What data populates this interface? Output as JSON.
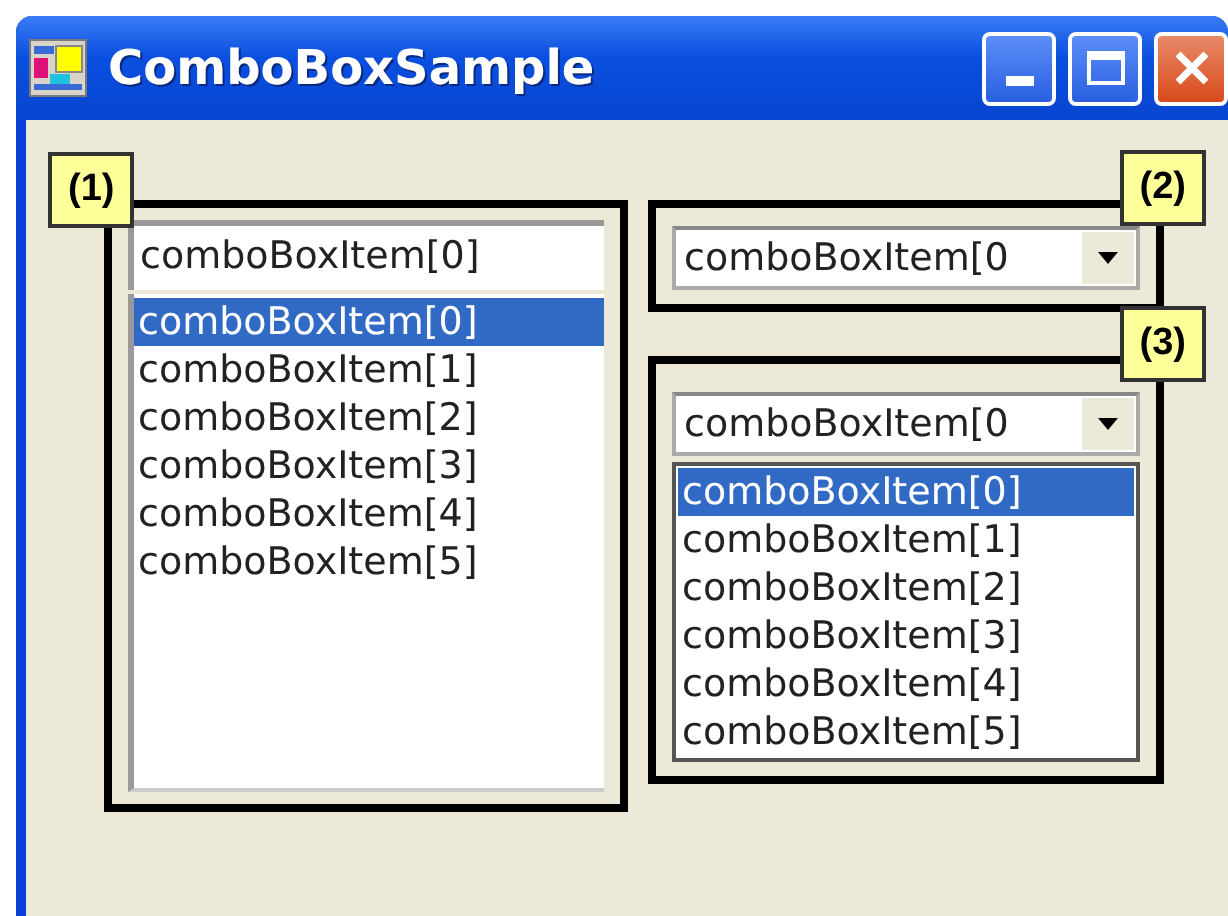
{
  "window": {
    "title": "ComboBoxSample"
  },
  "combo_boxes": [
    {
      "callout": "(1)",
      "kind": "simple",
      "value": "comboBoxItem[0]",
      "items": [
        {
          "label": "comboBoxItem[0]",
          "selected": true
        },
        {
          "label": "comboBoxItem[1]",
          "selected": false
        },
        {
          "label": "comboBoxItem[2]",
          "selected": false
        },
        {
          "label": "comboBoxItem[3]",
          "selected": false
        },
        {
          "label": "comboBoxItem[4]",
          "selected": false
        },
        {
          "label": "comboBoxItem[5]",
          "selected": false
        }
      ]
    },
    {
      "callout": "(2)",
      "kind": "dropdown",
      "value": "comboBoxItem[0",
      "expanded": false
    },
    {
      "callout": "(3)",
      "kind": "dropdown",
      "value": "comboBoxItem[0",
      "expanded": true,
      "items": [
        {
          "label": "comboBoxItem[0]",
          "selected": true
        },
        {
          "label": "comboBoxItem[1]",
          "selected": false
        },
        {
          "label": "comboBoxItem[2]",
          "selected": false
        },
        {
          "label": "comboBoxItem[3]",
          "selected": false
        },
        {
          "label": "comboBoxItem[4]",
          "selected": false
        },
        {
          "label": "comboBoxItem[5]",
          "selected": false
        }
      ]
    }
  ]
}
